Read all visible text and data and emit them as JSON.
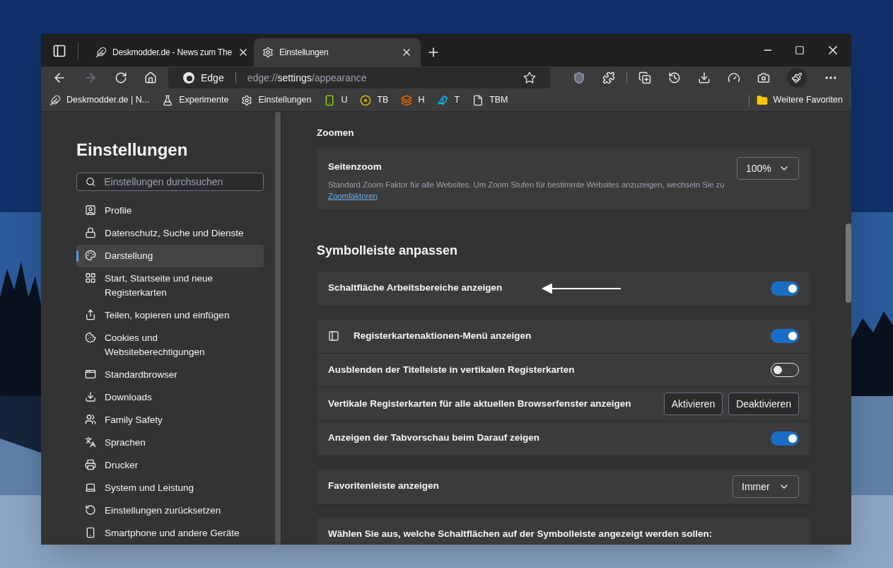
{
  "tabs": [
    {
      "title": "Deskmodder.de - News zum The",
      "selected": false
    },
    {
      "title": "Einstellungen",
      "selected": true
    }
  ],
  "address": {
    "site": "Edge",
    "url_scheme": "edge://",
    "url_host": "settings",
    "url_path": "/appearance"
  },
  "favorites": [
    {
      "label": "Deskmodder.de | N..."
    },
    {
      "label": "Experimente"
    },
    {
      "label": "Einstellungen"
    },
    {
      "label": "U"
    },
    {
      "label": "TB"
    },
    {
      "label": "H"
    },
    {
      "label": "T"
    },
    {
      "label": "TBM"
    }
  ],
  "other_favorites": "Weitere Favoriten",
  "sidebar": {
    "title": "Einstellungen",
    "search_placeholder": "Einstellungen durchsuchen",
    "items": [
      {
        "label": "Profile",
        "selected": false
      },
      {
        "label": "Datenschutz, Suche und Dienste",
        "selected": false
      },
      {
        "label": "Darstellung",
        "selected": true
      },
      {
        "label": "Start, Startseite und neue Registerkarten",
        "selected": false
      },
      {
        "label": "Teilen, kopieren und einfügen",
        "selected": false
      },
      {
        "label": "Cookies und Websiteberechtigungen",
        "selected": false
      },
      {
        "label": "Standardbrowser",
        "selected": false
      },
      {
        "label": "Downloads",
        "selected": false
      },
      {
        "label": "Family Safety",
        "selected": false
      },
      {
        "label": "Sprachen",
        "selected": false
      },
      {
        "label": "Drucker",
        "selected": false
      },
      {
        "label": "System und Leistung",
        "selected": false
      },
      {
        "label": "Einstellungen zurücksetzen",
        "selected": false
      },
      {
        "label": "Smartphone und andere Geräte",
        "selected": false
      }
    ]
  },
  "zoom": {
    "heading": "Zoomen",
    "title": "Seitenzoom",
    "description": "Standard Zoom Faktor für alle Websites. Um Zoom Stufen für bestimmte Websites anzuzeigen, wechseln Sie zu",
    "link": "Zoomfaktoren",
    "value": "100%"
  },
  "toolbar_section": {
    "heading": "Symbolleiste anpassen",
    "cards": [
      {
        "rows": [
          {
            "kind": "toggle",
            "label": "Schaltfläche Arbeitsbereiche anzeigen",
            "on": true,
            "annotated": true
          }
        ]
      },
      {
        "rows": [
          {
            "kind": "toggle",
            "label": "Registerkartenaktionen-Menü anzeigen",
            "on": true,
            "icon": true
          },
          {
            "kind": "toggle",
            "label": "Ausblenden der Titelleiste in vertikalen Registerkarten",
            "on": false
          },
          {
            "kind": "buttons",
            "label": "Vertikale Registerkarten für alle aktuellen Browserfenster anzeigen",
            "buttons": [
              "Aktivieren",
              "Deaktivieren"
            ]
          },
          {
            "kind": "toggle",
            "label": "Anzeigen der Tabvorschau beim Darauf zeigen",
            "on": true
          }
        ]
      },
      {
        "rows": [
          {
            "kind": "dropdown",
            "label": "Favoritenleiste anzeigen",
            "value": "Immer"
          }
        ]
      },
      {
        "rows": [
          {
            "kind": "text",
            "label": "Wählen Sie aus, welche Schaltflächen auf der Symbolleiste angezeigt werden sollen:"
          }
        ]
      }
    ]
  }
}
